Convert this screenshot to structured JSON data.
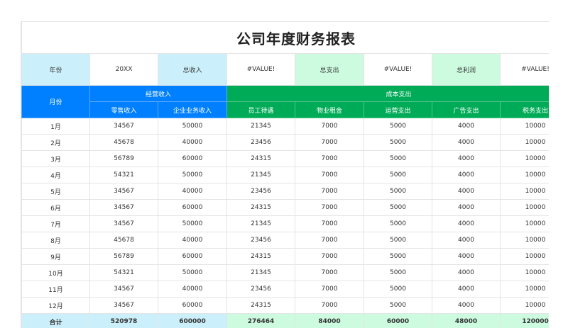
{
  "title": "公司年度财务报表",
  "info": {
    "year_label": "年份",
    "year_value": "20XX",
    "income_label": "总收入",
    "income_value": "#VALUE!",
    "expense_label": "总支出",
    "expense_value": "#VALUE!",
    "profit_label": "总利润",
    "profit_value": "#VALUE!"
  },
  "header": {
    "month": "月份",
    "income_group": "经营收入",
    "cost_group": "成本支出",
    "columns": [
      "零售收入",
      "企业业务收入",
      "员工待遇",
      "物业租金",
      "运营支出",
      "广告支出",
      "税务支出"
    ]
  },
  "rows": [
    [
      "1月",
      "34567",
      "50000",
      "21345",
      "7000",
      "5000",
      "4000",
      "10000"
    ],
    [
      "2月",
      "45678",
      "40000",
      "23456",
      "7000",
      "5000",
      "4000",
      "10000"
    ],
    [
      "3月",
      "56789",
      "60000",
      "24315",
      "7000",
      "5000",
      "4000",
      "10000"
    ],
    [
      "4月",
      "54321",
      "50000",
      "21345",
      "7000",
      "5000",
      "4000",
      "10000"
    ],
    [
      "5月",
      "34567",
      "40000",
      "23456",
      "7000",
      "5000",
      "4000",
      "10000"
    ],
    [
      "6月",
      "34567",
      "60000",
      "24315",
      "7000",
      "5000",
      "4000",
      "10000"
    ],
    [
      "7月",
      "34567",
      "50000",
      "21345",
      "7000",
      "5000",
      "4000",
      "10000"
    ],
    [
      "8月",
      "45678",
      "40000",
      "23456",
      "7000",
      "5000",
      "4000",
      "10000"
    ],
    [
      "9月",
      "56789",
      "60000",
      "24315",
      "7000",
      "5000",
      "4000",
      "10000"
    ],
    [
      "10月",
      "54321",
      "50000",
      "21345",
      "7000",
      "5000",
      "4000",
      "10000"
    ],
    [
      "11月",
      "34567",
      "40000",
      "23456",
      "7000",
      "5000",
      "4000",
      "10000"
    ],
    [
      "12月",
      "34567",
      "60000",
      "24315",
      "7000",
      "5000",
      "4000",
      "10000"
    ]
  ],
  "total": [
    "合计",
    "520978",
    "600000",
    "276464",
    "84000",
    "60000",
    "48000",
    "120000"
  ]
}
